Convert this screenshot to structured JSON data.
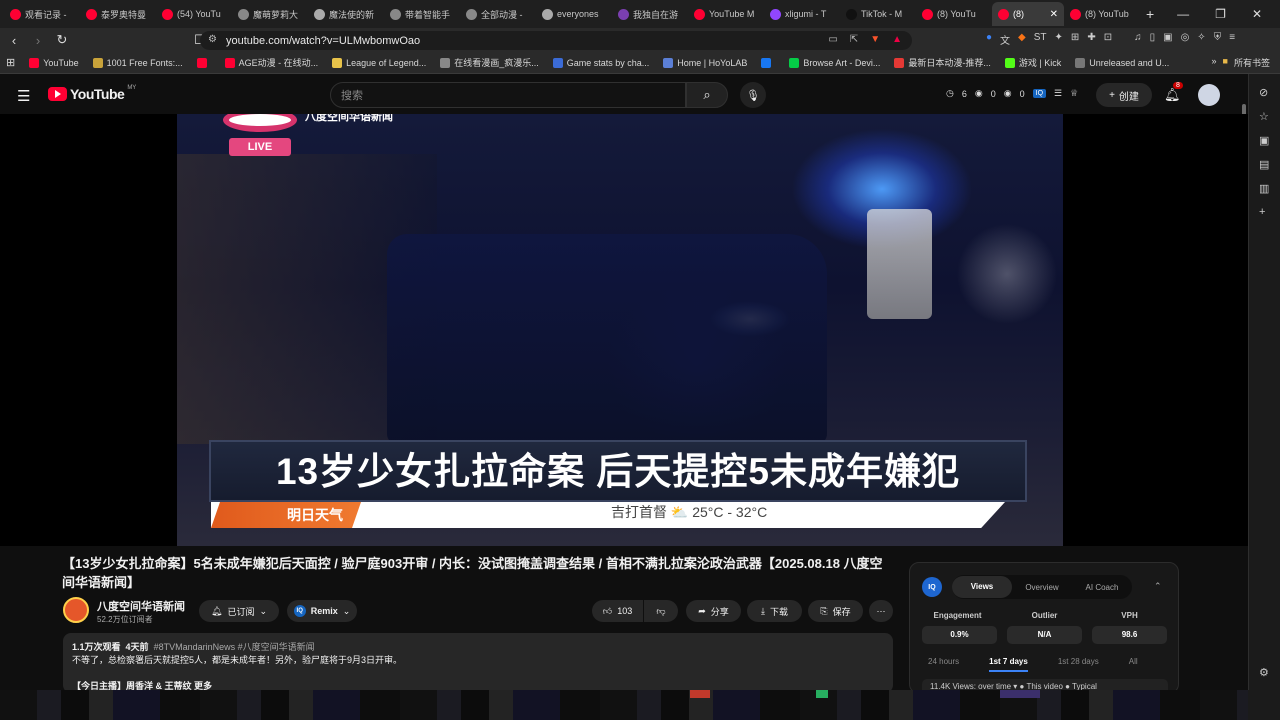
{
  "browser": {
    "tabs": [
      {
        "label": "观看记录 -",
        "favicon_color": "#ff0033",
        "active": false
      },
      {
        "label": "泰罗奥特曼",
        "favicon_color": "#ff0033",
        "active": false
      },
      {
        "label": "(54) YouTu",
        "favicon_color": "#ff0033",
        "active": false
      },
      {
        "label": "魔萌萝莉大",
        "favicon_color": "#888888",
        "active": false
      },
      {
        "label": "魔法使的新",
        "favicon_color": "#aaaaaa",
        "active": false
      },
      {
        "label": "带着智能手",
        "favicon_color": "#888888",
        "active": false
      },
      {
        "label": "全部动漫 -",
        "favicon_color": "#888888",
        "active": false
      },
      {
        "label": "everyones",
        "favicon_color": "#aaaaaa",
        "active": false
      },
      {
        "label": "我独自在游",
        "favicon_color": "#7b3fb0",
        "active": false
      },
      {
        "label": "YouTube M",
        "favicon_color": "#ff0033",
        "active": false
      },
      {
        "label": "xligumi - T",
        "favicon_color": "#9146ff",
        "active": false
      },
      {
        "label": "TikTok - M",
        "favicon_color": "#111111",
        "active": false
      },
      {
        "label": "(8) YouTu",
        "favicon_color": "#ff0033",
        "active": false
      },
      {
        "label": "(8)",
        "favicon_color": "#ff0033",
        "active": true
      },
      {
        "label": "(8) YouTub",
        "favicon_color": "#ff0033",
        "active": false
      }
    ],
    "new_tab": "+",
    "url": "youtube.com/watch?v=ULMwbomwOao",
    "bookmarks": [
      {
        "label": "YouTube",
        "color": "#ff0033"
      },
      {
        "label": "1001 Free Fonts:...",
        "color": "#c9a33a"
      },
      {
        "label": "",
        "color": "#ff0033"
      },
      {
        "label": "AGE动漫 - 在线动...",
        "color": "#ff0033"
      },
      {
        "label": "League of Legend...",
        "color": "#e8c34a"
      },
      {
        "label": "在线看漫画_疯漫乐...",
        "color": "#888888"
      },
      {
        "label": "Game stats by cha...",
        "color": "#3b6bd6"
      },
      {
        "label": "Home | HoYoLAB",
        "color": "#5b7fd6"
      },
      {
        "label": "",
        "color": "#1877f2"
      },
      {
        "label": "Browse Art - Devi...",
        "color": "#05cc47"
      },
      {
        "label": "最新日本动漫-推荐...",
        "color": "#e53935"
      },
      {
        "label": "游戏 | Kick",
        "color": "#53fc18"
      },
      {
        "label": "Unreleased and U...",
        "color": "#777777"
      }
    ],
    "bookmarks_more": "»",
    "all_bookmarks": "所有书签"
  },
  "youtube": {
    "logo_text": "YouTube",
    "region": "MY",
    "search_placeholder": "搜索",
    "header_stats": {
      "a": "6",
      "b": "0",
      "c": "0"
    },
    "create_label": "创建",
    "notifications": "8"
  },
  "video": {
    "overlay_channel": "八度空间华语新闻",
    "live_label": "LIVE",
    "headline": "13岁少女扎拉命案  后天提控5未成年嫌犯",
    "ticker_left": "明日天气",
    "ticker_right": "吉打首督 ⛅ 25°C - 32°C"
  },
  "meta": {
    "title": "【13岁少女扎拉命案】5名未成年嫌犯后天面控 / 验尸庭903开审 / 内长：没试图掩盖调查结果 / 首相不满扎拉案沦政治武器【2025.08.18 八度空间华语新闻】",
    "channel": "八度空间华语新闻",
    "subscribers": "52.2万位订阅者",
    "subscribed_label": "已订阅",
    "remix_label": "Remix",
    "likes": "103",
    "share_label": "分享",
    "download_label": "下载",
    "save_label": "保存",
    "views": "1.1万次观看",
    "age": "4天前",
    "tags": "#8TVMandarinNews #八度空间华语新闻",
    "description": "不等了，总检察署后天就提控5人，都是未成年者！另外，验尸庭将于9月3日开审。",
    "description_cut": "【今日主播】周香洋 & 王蒂纹    更多"
  },
  "iq_panel": {
    "logo": "IQ",
    "tabs": [
      "Views",
      "Overview",
      "AI Coach"
    ],
    "active_tab": "Views",
    "metrics": [
      {
        "label": "Engagement",
        "value": "0.9%"
      },
      {
        "label": "Outlier",
        "value": "N/A"
      },
      {
        "label": "VPH",
        "value": "98.6"
      }
    ],
    "ranges": [
      "24 hours",
      "1st 7 days",
      "1st 28 days",
      "All"
    ],
    "active_range": "1st 7 days",
    "footer": "11.4K   Views: over time ▾        ● This video  ● Typical"
  }
}
